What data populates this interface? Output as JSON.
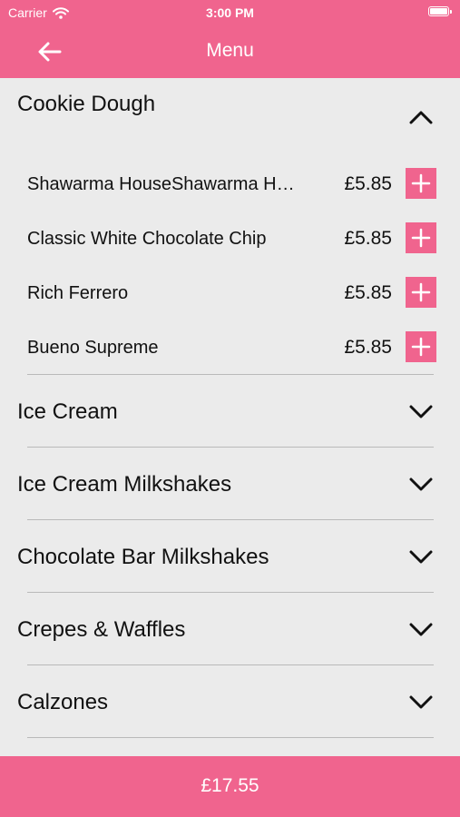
{
  "colors": {
    "brand": "#f0648e",
    "background": "#ebebeb"
  },
  "status_bar": {
    "carrier": "Carrier",
    "time": "3:00 PM"
  },
  "nav": {
    "title": "Menu",
    "back_icon": "arrow-left-icon"
  },
  "expanded_category": {
    "title": "Cookie Dough",
    "icon": "chevron-up-icon",
    "items": [
      {
        "name": "Shawarma HouseShawarma House",
        "price": "£5.85"
      },
      {
        "name": "Classic White Chocolate Chip",
        "price": "£5.85"
      },
      {
        "name": "Rich Ferrero",
        "price": "£5.85"
      },
      {
        "name": "Bueno Supreme",
        "price": "£5.85"
      }
    ]
  },
  "categories": [
    {
      "title": "Ice Cream",
      "icon": "chevron-down-icon"
    },
    {
      "title": "Ice Cream Milkshakes",
      "icon": "chevron-down-icon"
    },
    {
      "title": "Chocolate Bar Milkshakes",
      "icon": "chevron-down-icon"
    },
    {
      "title": "Crepes & Waffles",
      "icon": "chevron-down-icon"
    },
    {
      "title": "Calzones",
      "icon": "chevron-down-icon"
    }
  ],
  "footer": {
    "total": "£17.55"
  }
}
